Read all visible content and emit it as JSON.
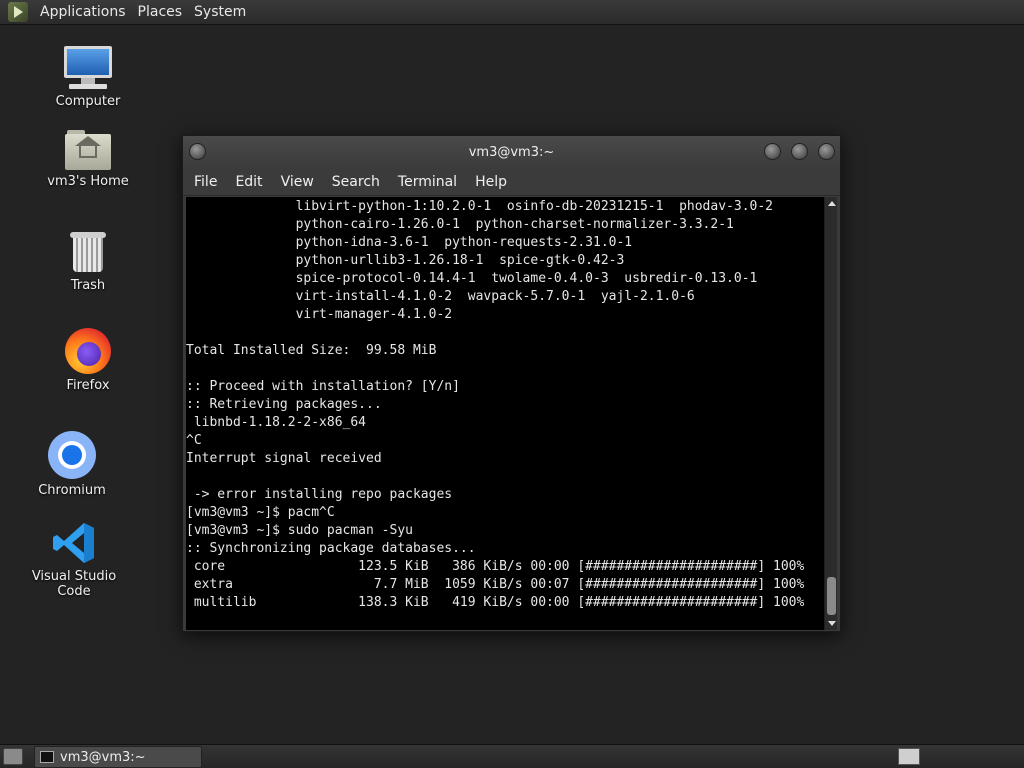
{
  "top_panel": {
    "menus": [
      "Applications",
      "Places",
      "System"
    ]
  },
  "desktop_icons": {
    "computer": "Computer",
    "home": "vm3's Home",
    "trash": "Trash",
    "firefox": "Firefox",
    "chromium": "Chromium",
    "vscode": "Visual Studio Code"
  },
  "terminal": {
    "title": "vm3@vm3:~",
    "menu": [
      "File",
      "Edit",
      "View",
      "Search",
      "Terminal",
      "Help"
    ],
    "lines": [
      "              libvirt-python-1:10.2.0-1  osinfo-db-20231215-1  phodav-3.0-2",
      "              python-cairo-1.26.0-1  python-charset-normalizer-3.3.2-1",
      "              python-idna-3.6-1  python-requests-2.31.0-1",
      "              python-urllib3-1.26.18-1  spice-gtk-0.42-3",
      "              spice-protocol-0.14.4-1  twolame-0.4.0-3  usbredir-0.13.0-1",
      "              virt-install-4.1.0-2  wavpack-5.7.0-1  yajl-2.1.0-6",
      "              virt-manager-4.1.0-2",
      "",
      "Total Installed Size:  99.58 MiB",
      "",
      ":: Proceed with installation? [Y/n]",
      ":: Retrieving packages...",
      " libnbd-1.18.2-2-x86_64",
      "^C",
      "Interrupt signal received",
      "",
      " -> error installing repo packages",
      "[vm3@vm3 ~]$ pacm^C",
      "[vm3@vm3 ~]$ sudo pacman -Syu",
      ":: Synchronizing package databases...",
      " core                 123.5 KiB   386 KiB/s 00:00 [######################] 100%",
      " extra                  7.7 MiB  1059 KiB/s 00:07 [######################] 100%",
      " multilib             138.3 KiB   419 KiB/s 00:00 [######################] 100%"
    ]
  },
  "taskbar": {
    "window_label": "vm3@vm3:~"
  }
}
